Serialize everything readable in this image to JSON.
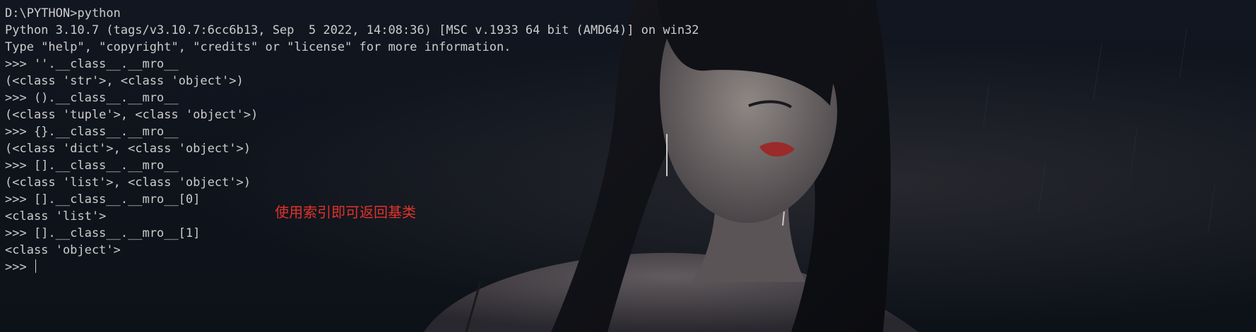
{
  "terminal": {
    "lines": [
      "D:\\PYTHON>python",
      "Python 3.10.7 (tags/v3.10.7:6cc6b13, Sep  5 2022, 14:08:36) [MSC v.1933 64 bit (AMD64)] on win32",
      "Type \"help\", \"copyright\", \"credits\" or \"license\" for more information.",
      ">>> ''.__class__.__mro__",
      "(<class 'str'>, <class 'object'>)",
      ">>> ().__class__.__mro__",
      "(<class 'tuple'>, <class 'object'>)",
      ">>> {}.__class__.__mro__",
      "(<class 'dict'>, <class 'object'>)",
      ">>> [].__class__.__mro__",
      "(<class 'list'>, <class 'object'>)",
      ">>> [].__class__.__mro__[0]",
      "<class 'list'>",
      ">>> [].__class__.__mro__[1]",
      "<class 'object'>"
    ],
    "prompt": ">>> "
  },
  "annotation": {
    "text": "使用索引即可返回基类",
    "color": "#e0332a"
  },
  "colors": {
    "background": "#0e1218",
    "text": "#cccccc"
  }
}
